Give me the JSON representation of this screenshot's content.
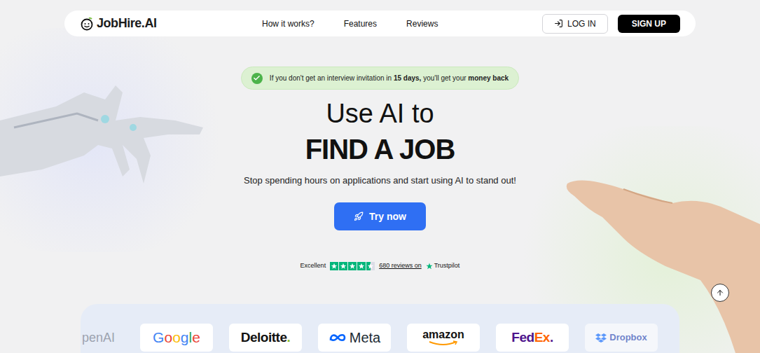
{
  "nav": {
    "logo": "JobHire.AI",
    "links": [
      "How it works?",
      "Features",
      "Reviews"
    ],
    "login": "LOG IN",
    "signup": "SIGN UP"
  },
  "banner": {
    "segments": [
      {
        "text": "If you don't get an interview invitation in ",
        "bold": false
      },
      {
        "text": "15 days,",
        "bold": true
      },
      {
        "text": " you'll get your ",
        "bold": false
      },
      {
        "text": "money back",
        "bold": true
      }
    ]
  },
  "hero": {
    "title": "Use AI to",
    "title_strong": "FIND A JOB",
    "subtitle": "Stop spending hours on applications and start using AI to stand out!",
    "cta": "Try now"
  },
  "rating": {
    "label": "Excellent",
    "stars": 4.5,
    "reviews": "680 reviews on",
    "source": "Trustpilot"
  },
  "logos": [
    {
      "kind": "bare",
      "faded": true,
      "segments": [
        {
          "text": "penAI",
          "color": "#6b7280"
        }
      ]
    },
    {
      "kind": "wordmark",
      "faded": false,
      "segments": [
        {
          "text": "G",
          "color": "#4285f4"
        },
        {
          "text": "o",
          "color": "#ea4335"
        },
        {
          "text": "o",
          "color": "#fbbc05"
        },
        {
          "text": "g",
          "color": "#4285f4"
        },
        {
          "text": "l",
          "color": "#34a853"
        },
        {
          "text": "e",
          "color": "#ea4335"
        }
      ]
    },
    {
      "kind": "bold",
      "faded": false,
      "segments": [
        {
          "text": "Deloitte",
          "color": "#111111"
        },
        {
          "text": ".",
          "color": "#86bc25"
        }
      ]
    },
    {
      "kind": "meta",
      "faded": false,
      "segments": [
        {
          "text": "Meta",
          "color": "#1c2b33"
        }
      ]
    },
    {
      "kind": "amazon",
      "faded": false,
      "segments": [
        {
          "text": "amazon",
          "color": "#111111"
        }
      ]
    },
    {
      "kind": "bold",
      "faded": false,
      "segments": [
        {
          "text": "Fed",
          "color": "#4d148c"
        },
        {
          "text": "Ex",
          "color": "#ff6600"
        },
        {
          "text": ".",
          "color": "#4d148c"
        }
      ]
    },
    {
      "kind": "dropbox",
      "faded": true,
      "segments": [
        {
          "text": "Dropbox",
          "color": "#1e40af"
        }
      ]
    }
  ]
}
